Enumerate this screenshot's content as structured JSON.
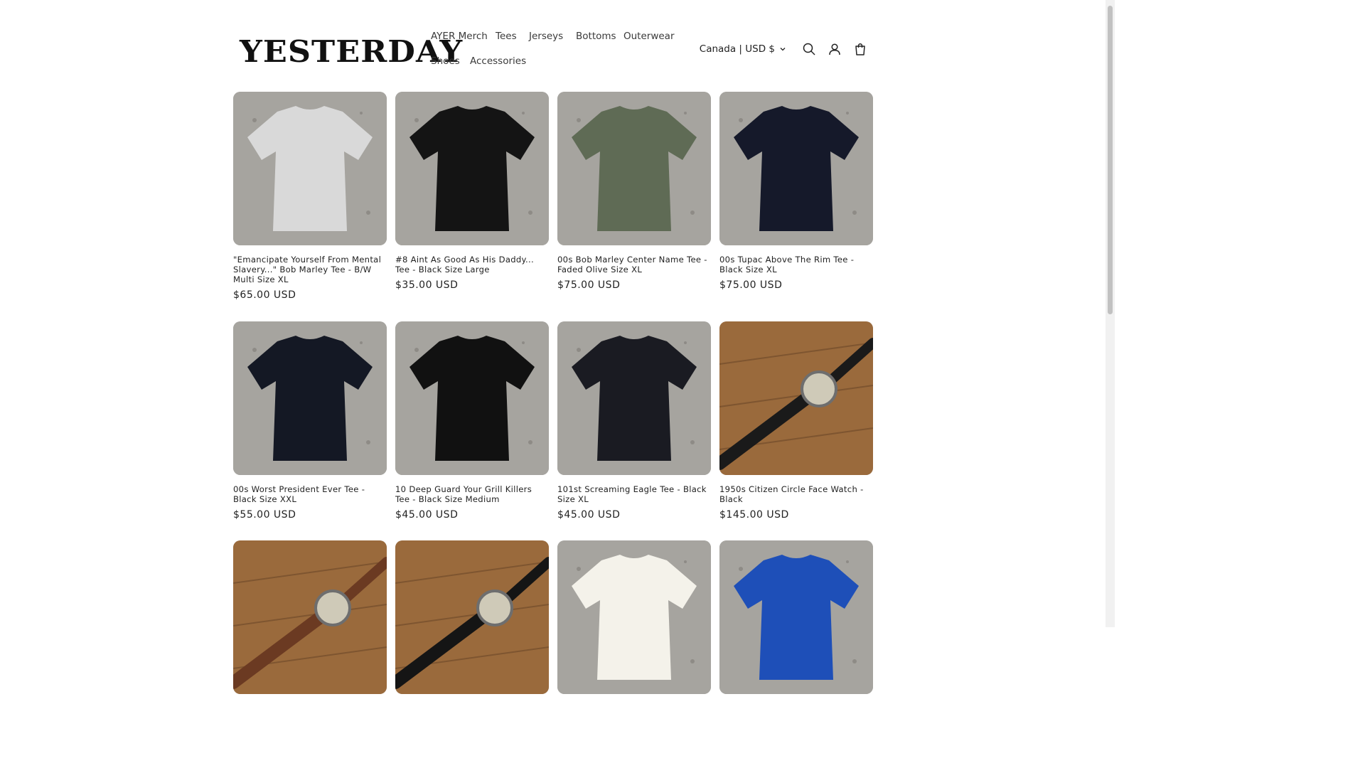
{
  "header": {
    "logo": "YESTERDAY",
    "nav": [
      {
        "label": "AYER Merch"
      },
      {
        "label": "Tees"
      },
      {
        "label": "Jerseys"
      },
      {
        "label": "Bottoms"
      },
      {
        "label": "Outerwear"
      },
      {
        "label": "Shoes"
      },
      {
        "label": "Accessories"
      }
    ],
    "locale": "Canada | USD $",
    "icons": [
      "search-icon",
      "account-icon",
      "cart-icon"
    ]
  },
  "products": [
    {
      "title": "\"Emancipate Yourself From Mental Slavery...\" Bob Marley Tee - B/W Multi Size XL",
      "price": "$65.00 USD",
      "shirt_color": "#d9d9d9"
    },
    {
      "title": "#8 Aint As Good As His Daddy... Tee - Black Size Large",
      "price": "$35.00 USD",
      "shirt_color": "#141414"
    },
    {
      "title": "00s Bob Marley Center Name Tee - Faded Olive Size XL",
      "price": "$75.00 USD",
      "shirt_color": "#5f6b55"
    },
    {
      "title": "00s Tupac Above The Rim Tee - Black Size XL",
      "price": "$75.00 USD",
      "shirt_color": "#15192a"
    },
    {
      "title": "00s Worst President Ever Tee - Black Size XXL",
      "price": "$55.00 USD",
      "shirt_color": "#141824"
    },
    {
      "title": "10 Deep Guard Your Grill Killers Tee - Black Size Medium",
      "price": "$45.00 USD",
      "shirt_color": "#111111"
    },
    {
      "title": "101st Screaming Eagle Tee - Black Size XL",
      "price": "$45.00 USD",
      "shirt_color": "#1a1b22"
    },
    {
      "title": "1950s Citizen Circle Face Watch - Black",
      "price": "$145.00 USD",
      "shirt_color": "#1a1a1a"
    },
    {
      "title": "",
      "price": "",
      "shirt_color": "#6b3a22"
    },
    {
      "title": "",
      "price": "",
      "shirt_color": "#151515"
    },
    {
      "title": "",
      "price": "",
      "shirt_color": "#f4f2ea"
    },
    {
      "title": "",
      "price": "",
      "shirt_color": "#1e4fb8"
    }
  ],
  "theme": {
    "accent": "#121212",
    "background": "#ffffff"
  }
}
